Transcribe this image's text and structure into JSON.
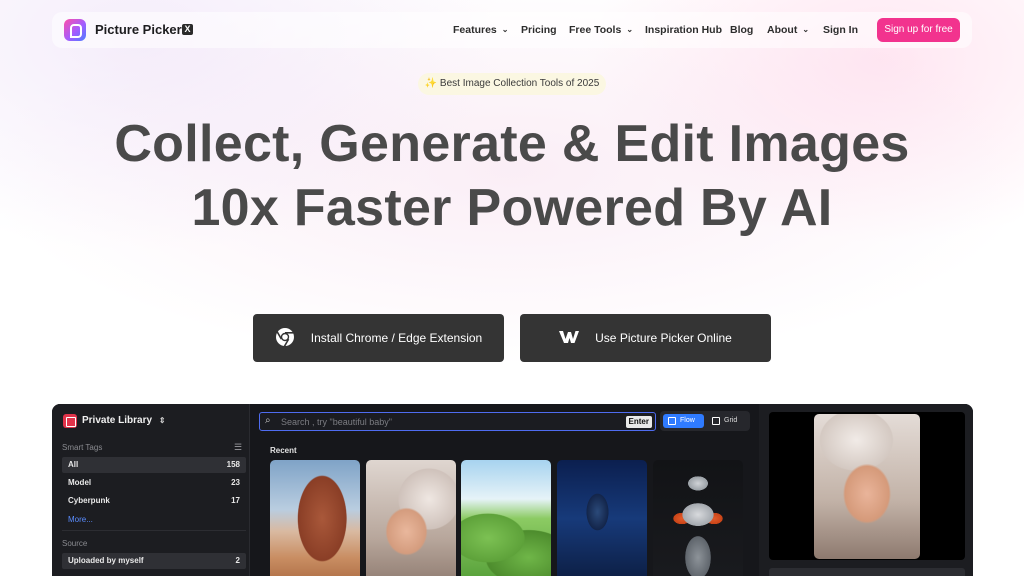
{
  "brand": {
    "name": "Picture Picker",
    "x_label": "X"
  },
  "nav": {
    "items": [
      "Features",
      "Pricing",
      "Free Tools",
      "Inspiration Hub",
      "Blog",
      "About"
    ],
    "signin": "Sign In",
    "signup": "Sign up for free"
  },
  "colors": {
    "accent": "#f2338e",
    "cta_bg": "#343434",
    "app_bg": "#16171b",
    "search_border": "#4f6cf0",
    "toggle_active": "#2f7bff"
  },
  "hero": {
    "badge": "✨ Best Image Collection Tools of 2025",
    "title_line1": "Collect, Generate & Edit Images",
    "title_line2": "10x Faster Powered By AI"
  },
  "cta": {
    "chrome": "Install Chrome / Edge Extension",
    "online": "Use Picture Picker Online"
  },
  "app": {
    "library_title": "Private Library",
    "smart_tags_label": "Smart Tags",
    "tags": [
      {
        "label": "All",
        "count": "158"
      },
      {
        "label": "Model",
        "count": "23"
      },
      {
        "label": "Cyberpunk",
        "count": "17"
      }
    ],
    "more": "More...",
    "source_label": "Source",
    "source_item": {
      "label": "Uploaded by myself",
      "count": "2"
    },
    "search_placeholder": "Search , try \"beautiful baby\"",
    "enter": "Enter",
    "view_flow": "Flow",
    "view_grid": "Grid",
    "recent": "Recent",
    "icons": [
      "library-icon",
      "chevron-updown-icon",
      "sort-icon",
      "search-icon",
      "flow-icon",
      "grid-icon",
      "chrome-icon",
      "webflow-icon"
    ]
  }
}
